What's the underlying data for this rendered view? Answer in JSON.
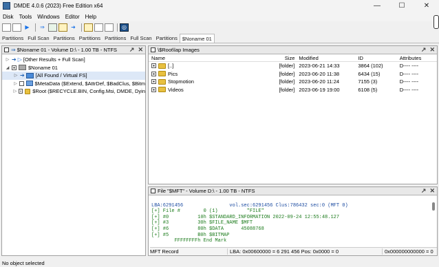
{
  "app": {
    "title": "DMDE 4.0.6 (2023) Free Edition x64",
    "min": "—",
    "max": "☐",
    "close": "✕"
  },
  "menu": [
    {
      "label": "Disk"
    },
    {
      "label": "Tools"
    },
    {
      "label": "Windows"
    },
    {
      "label": "Editor"
    },
    {
      "label": "Help"
    }
  ],
  "tabs": [
    "Partitions",
    "Full Scan",
    "Partitions",
    "Partitions",
    "Partitions",
    "Full Scan",
    "Partitions",
    "$Noname 01"
  ],
  "left_panel": {
    "title": "$Noname 01 - Volume D:\\ - 1.00 TB - NTFS",
    "items": [
      {
        "label": "[Other Results + Full Scan]"
      },
      {
        "label": "$Noname 01"
      },
      {
        "label": "[All Found / Virtual FS]"
      },
      {
        "label": "$MetaData ($Extend, $AttrDef, $BadClus, $Bitm"
      },
      {
        "label": "$Root ($RECYCLE.BIN, Config.Msi, DMDE, Dyin"
      }
    ]
  },
  "right_panel": {
    "title": "\\$Root\\lap Images",
    "columns": {
      "name": "Name",
      "size": "Size",
      "modified": "Modified",
      "id": "ID",
      "attributes": "Attributes"
    },
    "rows": [
      {
        "name": "[..]",
        "size": "[folder]",
        "modified": "2023-06-21 14:33",
        "id": "3864 (102)",
        "attributes": "D---- ----"
      },
      {
        "name": "Pics",
        "size": "[folder]",
        "modified": "2023-06-20 11:38",
        "id": "6434 (15)",
        "attributes": "D---- ----"
      },
      {
        "name": "Stopmotion",
        "size": "[folder]",
        "modified": "2023-06-20 11:24",
        "id": "7155 (3)",
        "attributes": "D---- ----"
      },
      {
        "name": "Videos",
        "size": "[folder]",
        "modified": "2023-06-19 19:00",
        "id": "6108 (5)",
        "attributes": "D---- ----"
      }
    ]
  },
  "bottom_panel": {
    "title": "File \"$MFT\" - Volume D:\\ - 1.00 TB - NTFS",
    "lines": [
      "LBA:6291456                vol.sec:6291456 Clus:786432 sec:0 (MFT 0)",
      "[+] File #        0 (1)          \"FILE\"",
      "[+] #0          10h $STANDARD_INFORMATION 2022-09-24 12:55:48.127",
      "[+] #3          30h $FILE_NAME $MFT",
      "[+] #6          80h $DATA      45088768",
      "[+] #5          B0h $BITMAP",
      "        FFFFFFFFh End Mark"
    ],
    "status": {
      "record": "MFT Record",
      "lba": "LBA: 0x00600000 = 6 291 456  Pos: 0x0000 = 0",
      "pos": "0x000000000000 = 0"
    }
  },
  "statusbar": "No object selected"
}
